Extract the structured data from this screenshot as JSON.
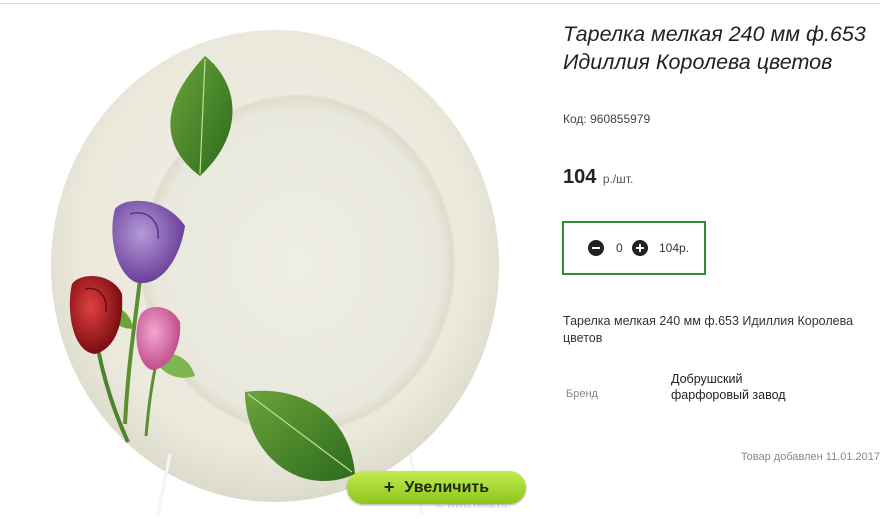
{
  "product": {
    "title": "Тарелка мелкая 240 мм ф.653 Идиллия Королева цветов",
    "code_label": "Код:",
    "code": "960855979",
    "price": "104",
    "price_unit": "р./шт.",
    "description": "Тарелка мелкая 240 мм ф.653 Идиллия Королева цветов",
    "brand_label": "Бренд",
    "brand_value": "Добрушский фарфоровый завод",
    "added_text": "Товар добавлен 11.01.2017"
  },
  "cart": {
    "quantity": "0",
    "sum": "104р."
  },
  "image": {
    "zoom_button_label": "Увеличить",
    "zoom_icon": "+",
    "watermark": "© www.relia.ru"
  },
  "icons": {
    "minus": "minus-circle-icon",
    "plus": "plus-circle-icon"
  },
  "colors": {
    "zoom_button": "#9fd52e",
    "qty_border": "#2f8e2f"
  }
}
